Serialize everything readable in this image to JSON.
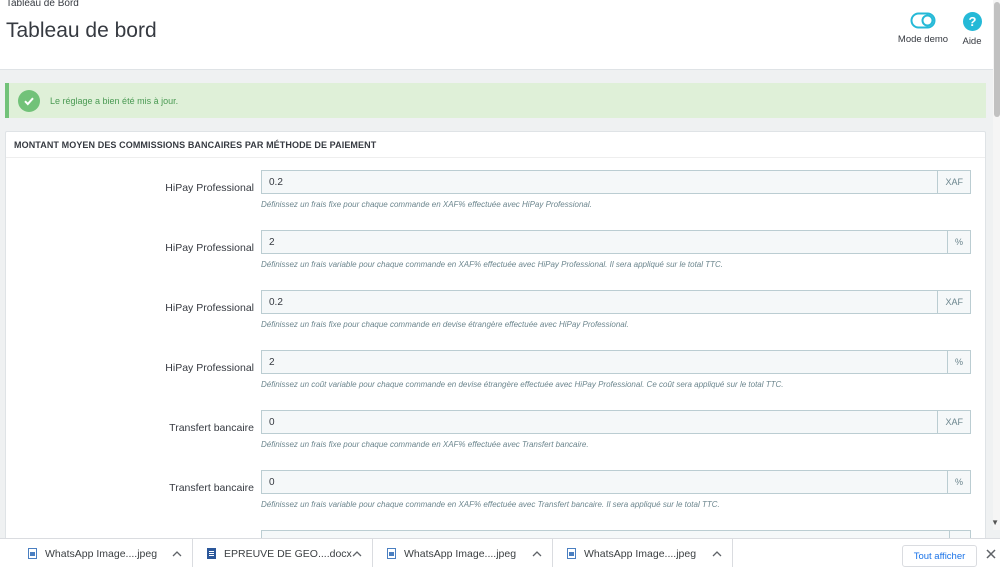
{
  "header": {
    "breadcrumb": "Tableau de Bord",
    "title": "Tableau de bord",
    "demo_label": "Mode demo",
    "help_label": "Aide"
  },
  "alert": {
    "message": "Le réglage a bien été mis à jour."
  },
  "panel": {
    "heading": "MONTANT MOYEN DES COMMISSIONS BANCAIRES PAR MÉTHODE DE PAIEMENT",
    "rows": [
      {
        "label": "HiPay Professional",
        "value": "0.2",
        "addon": "XAF",
        "help": "Définissez un frais fixe pour chaque commande en XAF% effectuée avec HiPay Professional."
      },
      {
        "label": "HiPay Professional",
        "value": "2",
        "addon": "%",
        "help": "Définissez un frais variable pour chaque commande en XAF% effectuée avec HiPay Professional. Il sera appliqué sur le total TTC."
      },
      {
        "label": "HiPay Professional",
        "value": "0.2",
        "addon": "XAF",
        "help": "Définissez un frais fixe pour chaque commande en devise étrangère effectuée avec HiPay Professional."
      },
      {
        "label": "HiPay Professional",
        "value": "2",
        "addon": "%",
        "help": "Définissez un coût variable pour chaque commande en devise étrangère effectuée avec HiPay Professional. Ce coût sera appliqué sur le total TTC."
      },
      {
        "label": "Transfert bancaire",
        "value": "0",
        "addon": "XAF",
        "help": "Définissez un frais fixe pour chaque commande en XAF% effectuée avec Transfert bancaire."
      },
      {
        "label": "Transfert bancaire",
        "value": "0",
        "addon": "%",
        "help": "Définissez un frais variable pour chaque commande en XAF% effectuée avec Transfert bancaire. Il sera appliqué sur le total TTC."
      }
    ]
  },
  "downloads": {
    "items": [
      {
        "name": "WhatsApp Image....jpeg",
        "icon": "image-file-icon"
      },
      {
        "name": "EPREUVE DE GEO....docx",
        "icon": "word-file-icon"
      },
      {
        "name": "WhatsApp Image....jpeg",
        "icon": "image-file-icon"
      },
      {
        "name": "WhatsApp Image....jpeg",
        "icon": "image-file-icon"
      }
    ],
    "show_all": "Tout afficher"
  },
  "colors": {
    "accent": "#25b9d7",
    "success": "#72c279",
    "success_bg": "#dff0d8",
    "link": "#1a73e8"
  }
}
